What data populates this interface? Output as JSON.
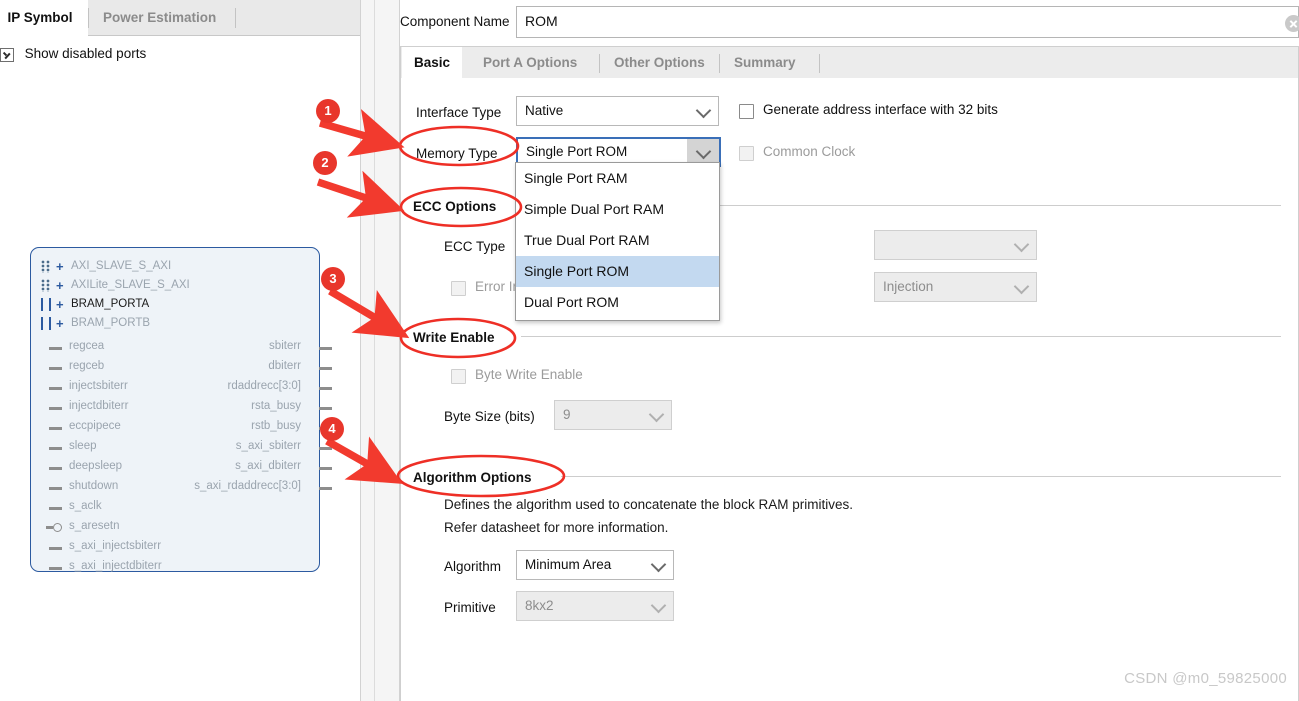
{
  "left_panel": {
    "tabs": [
      {
        "label": "IP Symbol",
        "active": true
      },
      {
        "label": "Power Estimation",
        "active": false
      }
    ],
    "show_disabled_ports": {
      "label": "Show disabled ports",
      "checked": true
    },
    "symbol": {
      "buses": [
        {
          "name": "AXI_SLAVE_S_AXI",
          "enabled": false,
          "mark": "dots"
        },
        {
          "name": "AXILite_SLAVE_S_AXI",
          "enabled": false,
          "mark": "dots"
        },
        {
          "name": "BRAM_PORTA",
          "enabled": true,
          "mark": "bars"
        },
        {
          "name": "BRAM_PORTB",
          "enabled": false,
          "mark": "bars"
        }
      ],
      "left_ports": [
        {
          "name": "regcea",
          "type": "line"
        },
        {
          "name": "regceb",
          "type": "line"
        },
        {
          "name": "injectsbiterr",
          "type": "line"
        },
        {
          "name": "injectdbiterr",
          "type": "line"
        },
        {
          "name": "eccpipece",
          "type": "line"
        },
        {
          "name": "sleep",
          "type": "line"
        },
        {
          "name": "deepsleep",
          "type": "line"
        },
        {
          "name": "shutdown",
          "type": "line"
        },
        {
          "name": "s_aclk",
          "type": "line"
        },
        {
          "name": "s_aresetn",
          "type": "invert"
        },
        {
          "name": "s_axi_injectsbiterr",
          "type": "line"
        },
        {
          "name": "s_axi_injectdbiterr",
          "type": "line"
        }
      ],
      "right_ports": [
        {
          "name": "sbiterr"
        },
        {
          "name": "dbiterr"
        },
        {
          "name": "rdaddrecc[3:0]"
        },
        {
          "name": "rsta_busy"
        },
        {
          "name": "rstb_busy"
        },
        {
          "name": "s_axi_sbiterr"
        },
        {
          "name": "s_axi_dbiterr"
        },
        {
          "name": "s_axi_rdaddrecc[3:0]"
        }
      ]
    }
  },
  "right_panel": {
    "component_name": {
      "label": "Component Name",
      "value": "ROM"
    },
    "tabs": [
      {
        "label": "Basic",
        "active": true
      },
      {
        "label": "Port A Options",
        "active": false
      },
      {
        "label": "Other Options",
        "active": false
      },
      {
        "label": "Summary",
        "active": false
      }
    ],
    "basic": {
      "interface_type": {
        "label": "Interface Type",
        "value": "Native",
        "disabled": false
      },
      "memory_type": {
        "label": "Memory Type",
        "value": "Single Port ROM",
        "disabled": false,
        "open": true
      },
      "generate_address_interface": {
        "label": "Generate address interface with 32 bits",
        "checked": false,
        "disabled": false
      },
      "common_clock": {
        "label": "Common Clock",
        "checked": false,
        "disabled": true
      },
      "memory_type_options": [
        {
          "label": "Single Port RAM",
          "selected": false
        },
        {
          "label": "Simple Dual Port RAM",
          "selected": false
        },
        {
          "label": "True Dual Port RAM",
          "selected": false
        },
        {
          "label": "Single Port ROM",
          "selected": true
        },
        {
          "label": "Dual Port ROM",
          "selected": false
        }
      ],
      "ecc_options": {
        "heading": "ECC Options",
        "ecc_type": {
          "label": "ECC Type",
          "value": "",
          "disabled": true
        },
        "error_injection": {
          "label": "Error Injection",
          "checked": false,
          "disabled": true
        },
        "error_injection_type": {
          "value": "Injection",
          "disabled": true
        }
      },
      "write_enable": {
        "heading": "Write Enable",
        "byte_write_enable": {
          "label": "Byte Write Enable",
          "checked": false,
          "disabled": true
        },
        "byte_size": {
          "label": "Byte Size (bits)",
          "value": "9",
          "disabled": true
        }
      },
      "algorithm_options": {
        "heading": "Algorithm Options",
        "help_line1": "Defines the algorithm used to concatenate the block RAM primitives.",
        "help_line2": "Refer datasheet for more information.",
        "algorithm": {
          "label": "Algorithm",
          "value": "Minimum Area",
          "disabled": false
        },
        "primitive": {
          "label": "Primitive",
          "value": "8kx2",
          "disabled": true
        }
      }
    }
  },
  "annotations": {
    "markers": [
      {
        "number": "1",
        "target": "Memory Type"
      },
      {
        "number": "2",
        "target": "ECC Options"
      },
      {
        "number": "3",
        "target": "Write Enable"
      },
      {
        "number": "4",
        "target": "Algorithm Options"
      }
    ],
    "color": "#e8362b"
  },
  "watermark": "CSDN @m0_59825000"
}
